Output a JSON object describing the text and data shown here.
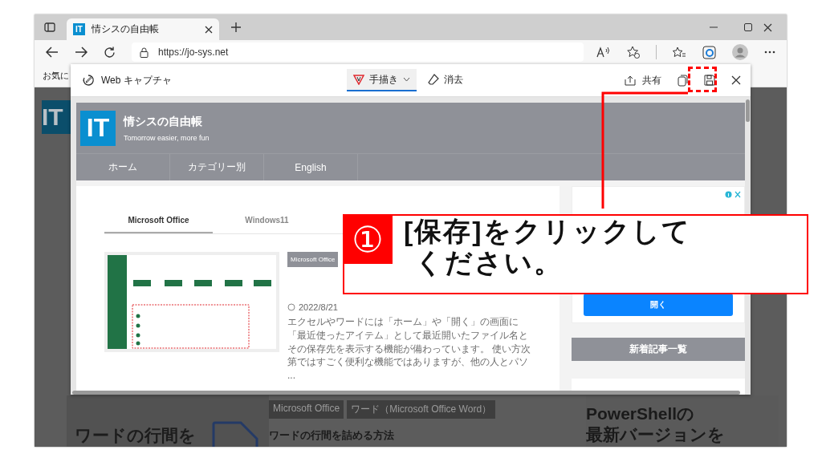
{
  "browser": {
    "tab_favicon": "IT",
    "tab_title": "情シスの自由帳",
    "url": "https://jo-sys.net",
    "bookmark": "お気に"
  },
  "capture_toolbar": {
    "title": "Web キャプチャ",
    "tools": [
      {
        "kind": "draw",
        "label": "手描き",
        "selected": true
      },
      {
        "kind": "erase",
        "label": "消去",
        "selected": false
      }
    ],
    "share": "共有"
  },
  "site": {
    "logo": "IT",
    "name": "情シスの自由帳",
    "tagline": "Tomorrow easier, more fun",
    "nav": [
      "ホーム",
      "カテゴリー別",
      "English"
    ],
    "tabs": [
      {
        "label": "Microsoft Office",
        "selected": true
      },
      {
        "label": "Windows11",
        "selected": false
      }
    ],
    "article": {
      "tags": [
        "Microsoft Office"
      ],
      "date": "2022/8/21",
      "excerpt": "エクセルやワードには「ホーム」や「開く」の画面に「最近使ったアイテム」として最近開いたファイル名とその保存先を表示する機能が備わっています。 使い方次第ではすごく便利な機能ではありますが、他の人とパソ ..."
    },
    "ad_button": "開く",
    "sidebar_heading": "新着記事一覧"
  },
  "background_page": {
    "logo": "IT",
    "left_heading": "ワードの行間を",
    "tags": [
      "Microsoft Office",
      "ワード（Microsoft Office Word）"
    ],
    "title": "ワードの行間を詰める方法",
    "right_heading": [
      "PowerShellの",
      "最新バージョンを"
    ]
  },
  "callout": {
    "number": "①",
    "lines": [
      "[保存]をクリックして",
      "ください。"
    ]
  }
}
